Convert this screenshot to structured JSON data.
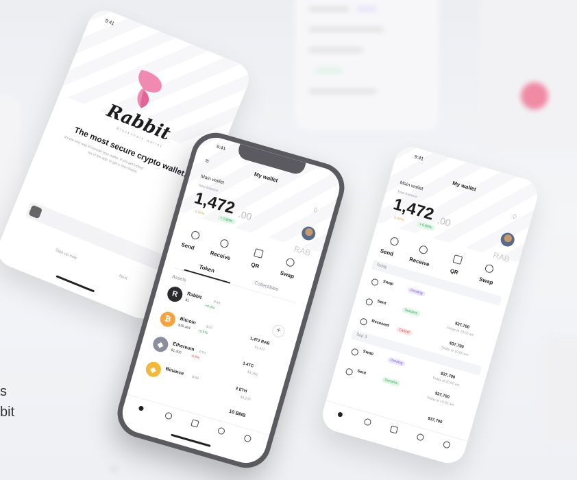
{
  "brand": {
    "name": "Rabbit",
    "sub": "Blockchain wallet"
  },
  "splash": {
    "time": "9:41",
    "tagline": "The most secure crypto wallet.",
    "desc1": "It's the only way to transfer your wallet. If you get locked",
    "desc2": "out of the app, or get a new device.",
    "sign_up": "Sign up now",
    "next": "Next"
  },
  "phone_center": {
    "time": "9:41",
    "title": "My wallet",
    "main_wallet": "Main wallet",
    "total_balance_label": "Total Balance",
    "balance": "1,472",
    "balance_dec": ".00",
    "change": "0.00%",
    "change_badge": "+ 0.00%",
    "rab": "RAB",
    "actions": [
      "Send",
      "Receive",
      "QR",
      "Swap"
    ],
    "tabs": [
      "Token",
      "Collectibles"
    ],
    "assets_label": "Assets",
    "assets": [
      {
        "name": "Rabbit",
        "ticker": "RAB",
        "price": "$1",
        "delta": "+0.0%",
        "amount": "",
        "usd": "",
        "color": "#2a2a2e",
        "glyph": "R"
      },
      {
        "name": "Bitcoin",
        "ticker": "BTC",
        "price": "$15,464",
        "delta": "+0.5%",
        "amount": "1,472 RAB",
        "usd": "$1,472",
        "color": "#f4a340",
        "glyph": "₿"
      },
      {
        "name": "Ethereum",
        "ticker": "ETH",
        "price": "$1,400",
        "delta": "-0.8%",
        "amount": "1.4TC",
        "usd": "$1,260",
        "color": "#8a8fa0",
        "glyph": "◆"
      },
      {
        "name": "Binance",
        "ticker": "BNB",
        "price": "",
        "delta": "",
        "amount": "2 ETH",
        "usd": "$3,200",
        "color": "#f2b83a",
        "glyph": "◈"
      }
    ],
    "last_amount": "10 BNB"
  },
  "phone_right": {
    "time": "9:41",
    "title": "My wallet",
    "main_wallet": "Main wallet",
    "total_balance_label": "Total Balance",
    "balance": "1,472",
    "balance_dec": ".00",
    "change": "0.00%",
    "change_badge": "+ 0.00%",
    "rab": "RAB",
    "actions": [
      "Send",
      "Receive",
      "QR",
      "Swap"
    ],
    "today_label": "Today",
    "sep_label": "Sep 3",
    "today_tx": [
      {
        "type": "Swap",
        "badge": "Pending",
        "badge_kind": "purple",
        "amount": "",
        "when": ""
      },
      {
        "type": "Sent",
        "badge": "Success",
        "badge_kind": "green",
        "amount": "$37,700",
        "when": "Today at 10:00 am"
      },
      {
        "type": "Received",
        "badge": "Cancel",
        "badge_kind": "red",
        "amount": "$37,700",
        "when": "Today at 10:00 am"
      }
    ],
    "sep_tx": [
      {
        "type": "Swap",
        "badge": "Pending",
        "badge_kind": "purple",
        "amount": "$37,700",
        "when": "Today at 10:00 am"
      },
      {
        "type": "Sent",
        "badge": "Success",
        "badge_kind": "green",
        "amount": "$37,700",
        "when": "Today at 10:00 am"
      }
    ],
    "extra_amount": "$37,700"
  },
  "left_caption": {
    "line1": "s",
    "line2": "bit"
  }
}
